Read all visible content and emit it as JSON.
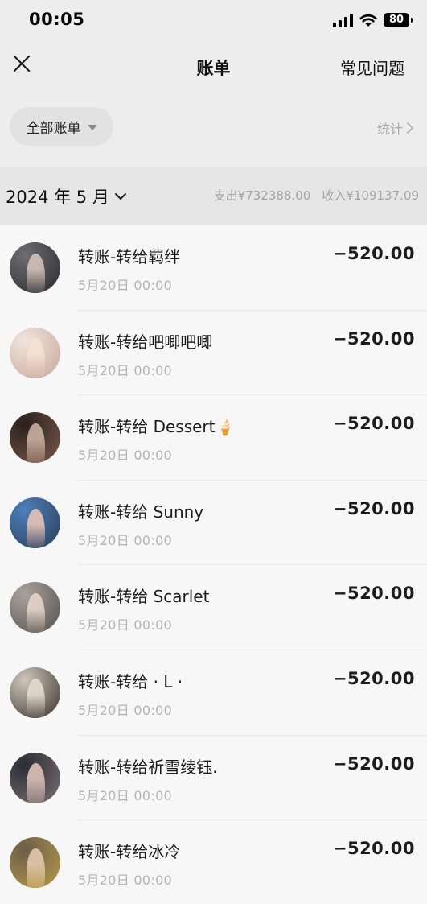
{
  "status_bar": {
    "time": "00:05",
    "battery": "80"
  },
  "nav": {
    "title": "账单",
    "faq": "常见问题"
  },
  "filter": {
    "label": "全部账单",
    "stats": "统计"
  },
  "month": {
    "label": "2024 年 5 月",
    "expense": "支出¥732388.00",
    "income": "收入¥109137.09"
  },
  "transactions": [
    {
      "title": "转账-转给羁绊",
      "time": "5月20日 00:00",
      "amount": "−520.00",
      "avatar_colors": [
        "#6d6d72",
        "#2c2a2e",
        "#d9c8bd"
      ]
    },
    {
      "title": "转账-转给吧唧吧唧",
      "time": "5月20日 00:00",
      "amount": "−520.00",
      "avatar_colors": [
        "#efe4dc",
        "#c9a99a",
        "#f4e2d2"
      ]
    },
    {
      "title": "转账-转给 Dessert🍦",
      "time": "5月20日 00:00",
      "amount": "−520.00",
      "avatar_colors": [
        "#2a1f1c",
        "#7a5a4c",
        "#d0b8a6"
      ]
    },
    {
      "title": "转账-转给 Sunny",
      "time": "5月20日 00:00",
      "amount": "−520.00",
      "avatar_colors": [
        "#4d7fb8",
        "#2b3d5c",
        "#eec9b9"
      ]
    },
    {
      "title": "转账-转给 Scarlet",
      "time": "5月20日 00:00",
      "amount": "−520.00",
      "avatar_colors": [
        "#a9a29c",
        "#55504b",
        "#ead8cc"
      ]
    },
    {
      "title": "转账-转给 · L ·",
      "time": "5月20日 00:00",
      "amount": "−520.00",
      "avatar_colors": [
        "#cfc7bb",
        "#3a332c",
        "#e8ddd0"
      ]
    },
    {
      "title": "转账-转给祈雪绫钰.",
      "time": "5月20日 00:00",
      "amount": "−520.00",
      "avatar_colors": [
        "#2b2c36",
        "#7c6f70",
        "#e5c9bf"
      ]
    },
    {
      "title": "转账-转给冰冷",
      "time": "5月20日 00:00",
      "amount": "−520.00",
      "avatar_colors": [
        "#6b5e48",
        "#b89a4a",
        "#e7cdb2"
      ]
    }
  ]
}
